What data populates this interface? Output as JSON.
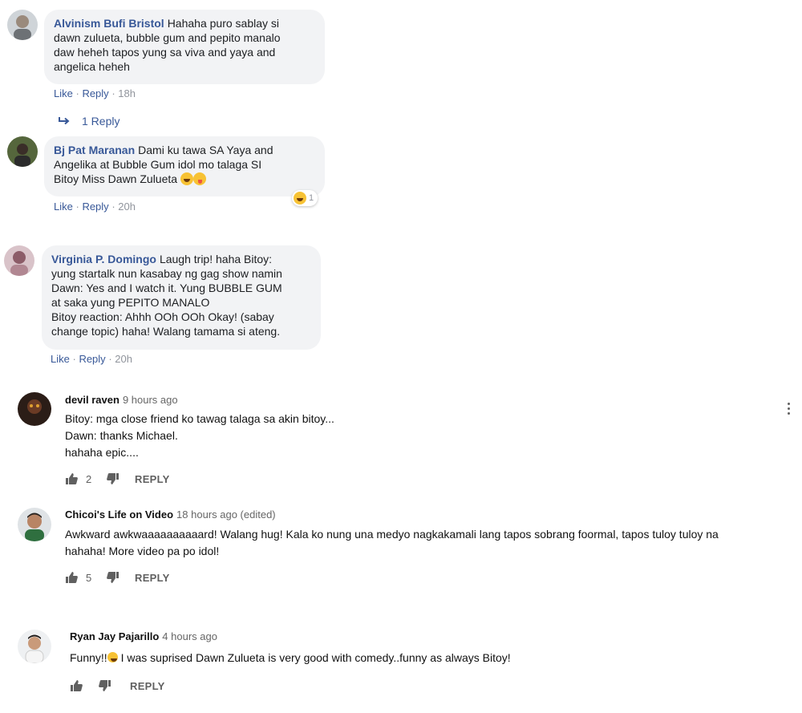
{
  "fb_comments": [
    {
      "name": "Alvinism Bufi Bristol",
      "lines": [
        "Hahaha puro sablay si",
        "dawn zulueta, bubble gum and pepito manalo",
        "daw heheh tapos yung sa viva and yaya and",
        "angelica heheh"
      ],
      "like": "Like",
      "reply": "Reply",
      "time": "18h",
      "replies_link": "1 Reply"
    },
    {
      "name": "Bj Pat Maranan",
      "lines": [
        "Dami ku tawa SA Yaya and",
        "Angelika at Bubble Gum idol mo talaga SI",
        "Bitoy Miss Dawn Zulueta"
      ],
      "like": "Like",
      "reply": "Reply",
      "time": "20h",
      "reaction_count": "1"
    },
    {
      "name": "Virginia P. Domingo",
      "lines": [
        "Laugh trip! haha Bitoy:",
        "yung startalk nun kasabay ng gag show namin",
        "Dawn: Yes and I watch it. Yung BUBBLE GUM",
        "at saka yung PEPITO MANALO",
        "Bitoy reaction: Ahhh OOh OOh Okay! (sabay",
        "change topic) haha! Walang tamama si ateng."
      ],
      "like": "Like",
      "reply": "Reply",
      "time": "20h"
    }
  ],
  "yt_comments": [
    {
      "author": "devil raven",
      "time": "9 hours ago",
      "lines": [
        "Bitoy: mga close friend ko tawag talaga sa akin bitoy...",
        "Dawn: thanks Michael.",
        "hahaha epic...."
      ],
      "likes": "2",
      "reply": "REPLY"
    },
    {
      "author": "Chicoi's Life on Video",
      "time": "18 hours ago (edited)",
      "lines": [
        "Awkward awkwaaaaaaaaaard! Walang hug! Kala ko nung una medyo nagkakamali lang tapos sobrang foormal, tapos tuloy tuloy na",
        "hahaha! More video pa po idol!"
      ],
      "likes": "5",
      "reply": "REPLY"
    },
    {
      "author": "Ryan Jay Pajarillo",
      "time": "4 hours ago",
      "text_before": "Funny!!",
      "text_after": " I was suprised Dawn Zulueta is very good with comedy..funny as always Bitoy!",
      "likes": "",
      "reply": "REPLY"
    }
  ],
  "colors": {
    "fb_link": "#385898",
    "fb_bubble": "#f2f3f5",
    "yt_text": "#111111",
    "yt_meta": "#606060"
  }
}
